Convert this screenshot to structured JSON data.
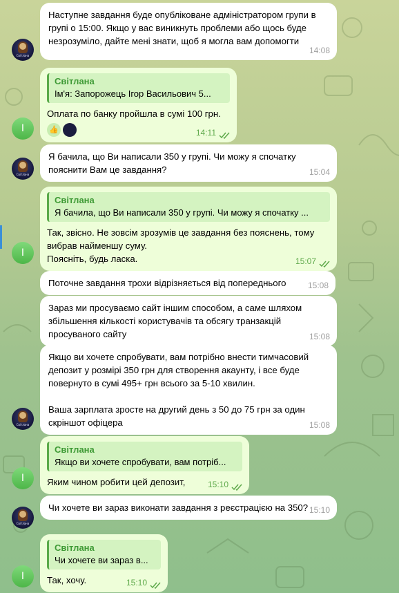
{
  "admin_avatar_label": "Світлана",
  "user_avatar_letter": "І",
  "messages": [
    {
      "text": "Наступне завдання буде опубліковане адміністратором групи в групі о 15:00. Якщо у вас виникнуть проблеми або щось буде незрозуміло, дайте мені знати, щоб я могла вам допомогти",
      "time": "14:08"
    },
    {
      "quote_name": "Світлана",
      "quote_text": "Ім'я:  Запорожець Ігор Васильович 5...",
      "text": "Оплата по банку пройшла в сумі 100 грн.",
      "time": "14:11",
      "reaction": "👍"
    },
    {
      "text": "Я бачила, що Ви написали 350 у групі. Чи можу я спочатку пояснити Вам це завдання?",
      "time": "15:04"
    },
    {
      "quote_name": "Світлана",
      "quote_text": "Я бачила, що Ви написали 350 у групі. Чи можу я спочатку ...",
      "text": "Так, звісно. Не зовсім зрозумів це завдання без пояснень, тому вибрав найменшу суму.\nПоясніть, будь ласка.",
      "time": "15:07"
    },
    {
      "text": "Поточне завдання трохи відрізняється від попереднього",
      "time": "15:08"
    },
    {
      "text": "Зараз ми просуваємо сайт іншим способом, а саме шляхом збільшення кількості користувачів та обсягу транзакцій просуваного сайту",
      "time": "15:08"
    },
    {
      "text": "Якщо ви хочете спробувати, вам потрібно внести тимчасовий депозит у розмірі 350 грн для створення акаунту, і все буде повернуто в сумі 495+ грн всього за 5-10 хвилин.\n\nВаша зарплата зросте на другий день з 50 до 75 грн за один скріншот офіцера",
      "time": "15:08"
    },
    {
      "quote_name": "Світлана",
      "quote_text": "Якщо ви хочете спробувати, вам потріб...",
      "text": "Яким чином робити цей депозит,",
      "time": "15:10"
    },
    {
      "text": "Чи хочете ви зараз виконати завдання з реєстрацією на 350?",
      "time": "15:10"
    },
    {
      "quote_name": "Світлана",
      "quote_text": "Чи хочете ви зараз в...",
      "text": "Так, хочу.",
      "time": "15:10"
    }
  ]
}
